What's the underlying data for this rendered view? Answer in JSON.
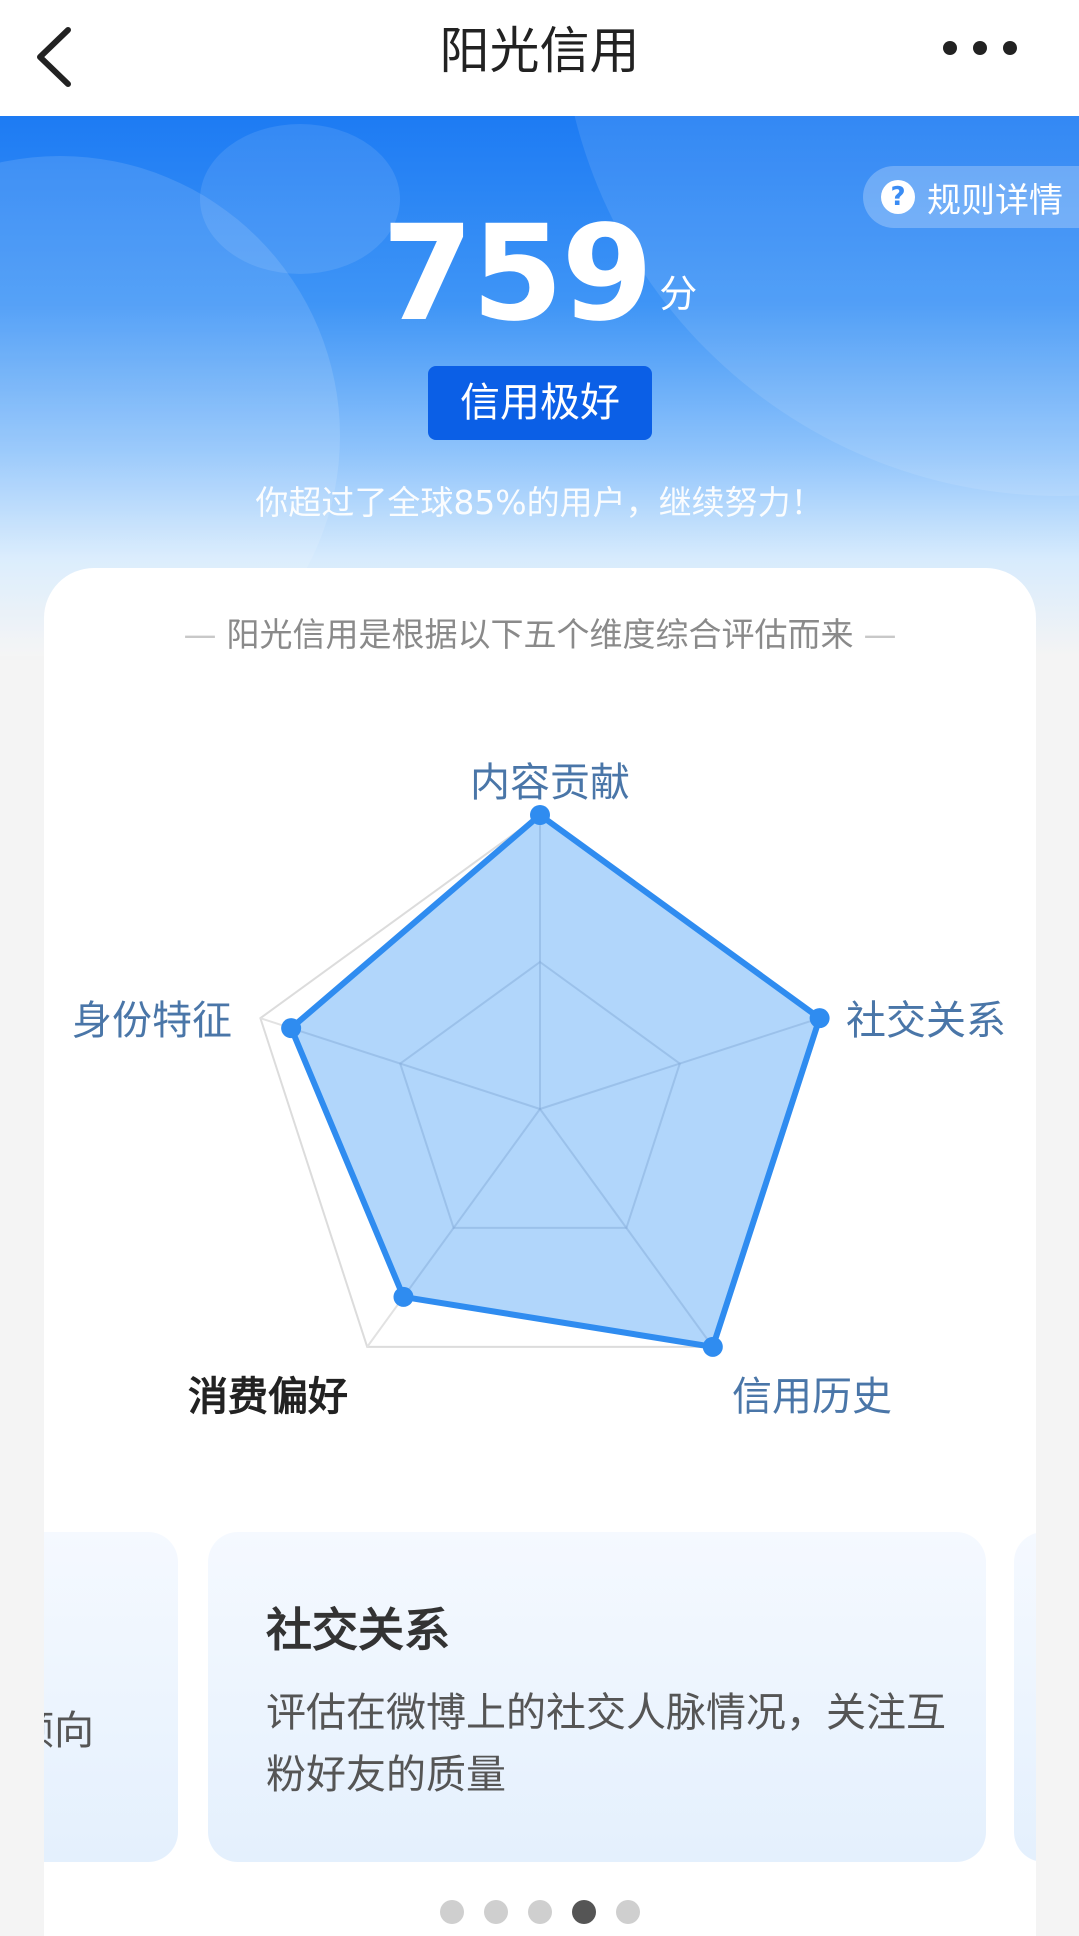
{
  "navbar": {
    "title": "阳光信用",
    "back_icon": "chevron-left-icon",
    "more_icon": "more-dots-icon"
  },
  "hero": {
    "rules_label": "规则详情",
    "score": "759",
    "score_unit": "分",
    "level": "信用极好",
    "rank_text": "你超过了全球85%的用户，继续努力！"
  },
  "card": {
    "subtitle": "阳光信用是根据以下五个维度综合评估而来"
  },
  "chart_data": {
    "type": "radar",
    "axes": [
      "内容贡献",
      "社交关系",
      "信用历史",
      "消费偏好",
      "身份特征"
    ],
    "values": [
      1.0,
      1.0,
      1.0,
      0.79,
      0.89
    ],
    "max": 1.0,
    "highlighted_axis": "消费偏好",
    "fill_color": "#a9d1fb",
    "stroke_color": "#2f8cf0"
  },
  "carousel": {
    "prev_fragment": "倾向",
    "current": {
      "title": "社交关系",
      "description": "评估在微博上的社交人脉情况，关注互粉好友的质量"
    },
    "dots": 5,
    "active_dot": 3
  },
  "colors": {
    "brand_blue": "#1d7bf3",
    "badge_blue": "#0b5fe6",
    "label_blue": "#4a76a8"
  }
}
